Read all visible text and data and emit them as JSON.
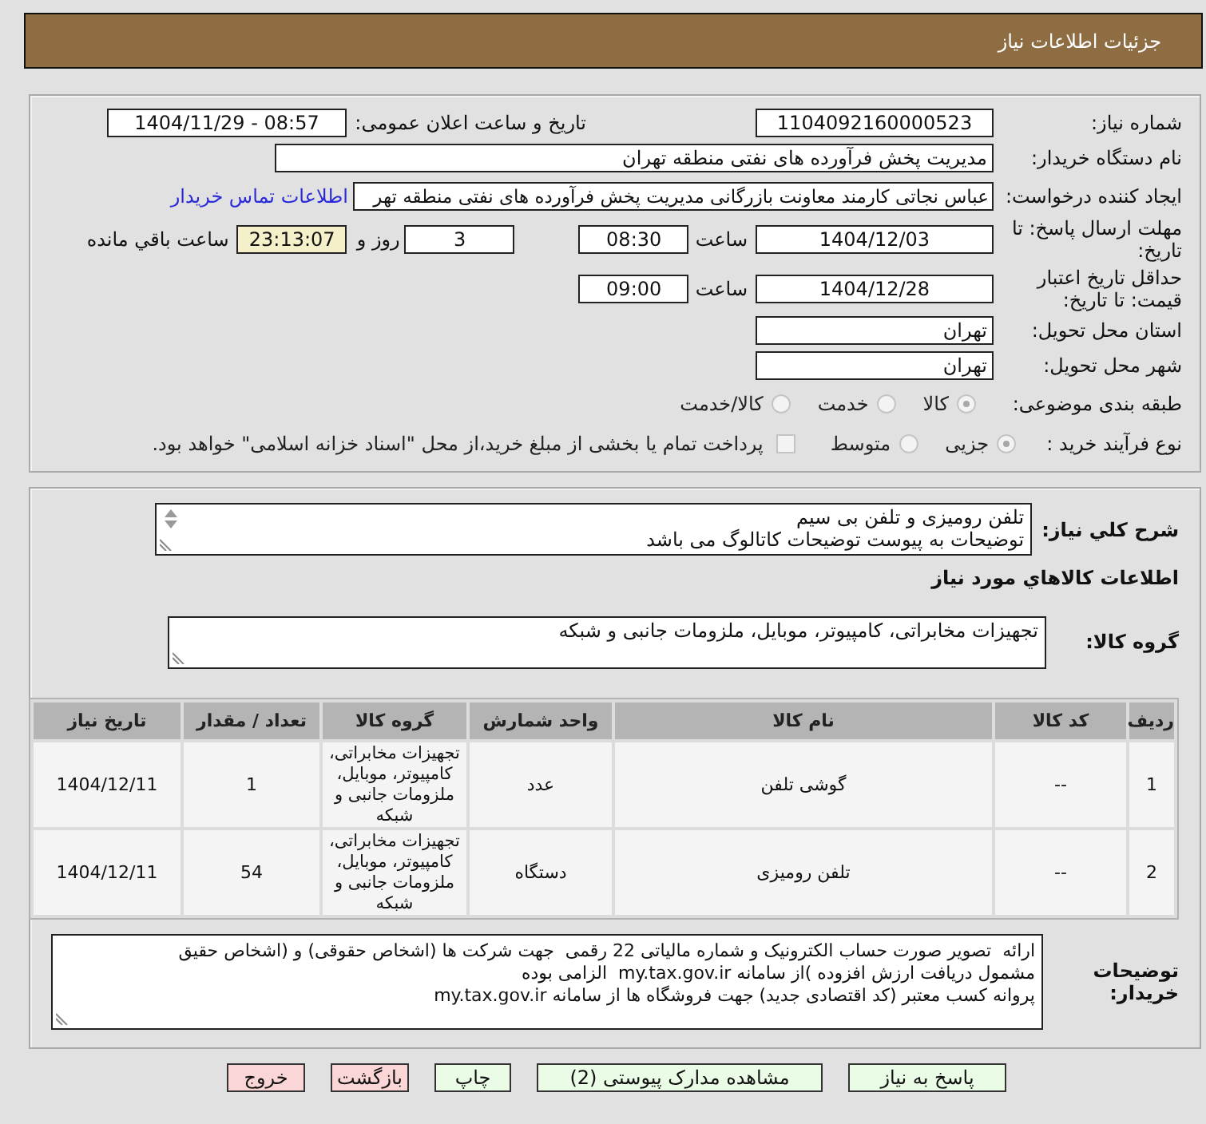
{
  "title_bar": {
    "title": "جزئیات اطلاعات نیاز"
  },
  "details": {
    "need_number": {
      "label": "شماره نیاز:",
      "value": "1104092160000523"
    },
    "announce": {
      "label": "تاریخ و ساعت اعلان عمومی:",
      "value": "1404/11/29 - 08:57"
    },
    "buyer": {
      "label": "نام دستگاه خریدار:",
      "value": "مدیریت پخش فرآورده های نفتی منطقه تهران"
    },
    "requester": {
      "label": "ایجاد کننده درخواست:",
      "value": "عباس نجاتی کارمند معاونت بازرگانی مدیریت پخش فرآورده های نفتی منطقه تهر",
      "link": "اطلاعات تماس خریدار"
    },
    "reply_deadline": {
      "label": "مهلت ارسال پاسخ: تا تاریخ:",
      "date": "1404/12/03",
      "time_label": "ساعت",
      "time": "08:30",
      "days": "3",
      "days_label": "روز و",
      "remaining": "23:13:07",
      "remaining_label": "ساعت باقي مانده"
    },
    "price_validity": {
      "label": "حداقل تاریخ اعتبار قیمت: تا تاریخ:",
      "date": "1404/12/28",
      "time_label": "ساعت",
      "time": "09:00"
    },
    "province": {
      "label": "استان محل تحویل:",
      "value": "تهران"
    },
    "city": {
      "label": "شهر محل تحویل:",
      "value": "تهران"
    },
    "category": {
      "label": "طبقه بندی موضوعی:",
      "options": [
        {
          "label": "کالا",
          "selected": true,
          "disabled": true
        },
        {
          "label": "خدمت",
          "selected": false,
          "disabled": true
        },
        {
          "label": "کالا/خدمت",
          "selected": false,
          "disabled": true
        }
      ]
    },
    "process": {
      "label": "نوع فرآیند خرید :",
      "options": [
        {
          "label": "جزیی",
          "selected": true,
          "disabled": true
        },
        {
          "label": "متوسط",
          "selected": false,
          "disabled": true
        }
      ],
      "treasury": {
        "label": "پرداخت تمام یا بخشی از مبلغ خرید،از محل \"اسناد خزانه اسلامی\" خواهد بود.",
        "checked": false,
        "disabled": true
      }
    }
  },
  "need": {
    "description_label": "شرح كلي نياز:",
    "description": "تلفن رومیزی و تلفن بی سیم\nتوضیحات به پیوست توضیحات کاتالوگ می باشد",
    "items_title": "اطلاعات كالاهاي مورد نياز",
    "group_label": "گروه کالا:",
    "group": "تجهیزات مخابراتی، کامپیوتر، موبایل، ملزومات جانبی و شبکه",
    "table": {
      "columns": [
        "ردیف",
        "کد کالا",
        "نام کالا",
        "واحد شمارش",
        "گروه کالا",
        "تعداد / مقدار",
        "تاریخ نیاز"
      ],
      "rows": [
        [
          "1",
          "--",
          "گوشی تلفن",
          "عدد",
          "تجهیزات مخابراتی، کامپیوتر، موبایل، ملزومات جانبی و شبکه",
          "1",
          "1404/12/11"
        ],
        [
          "2",
          "--",
          "تلفن رومیزی",
          "دستگاه",
          "تجهیزات مخابراتی، کامپیوتر، موبایل، ملزومات جانبی و شبکه",
          "54",
          "1404/12/11"
        ]
      ]
    },
    "notes_label": "توضیحات خریدار:",
    "notes": "ارائه  تصویر صورت حساب الکترونیک و شماره مالیاتی 22 رقمی  جهت شرکت ها (اشخاص حقوقی) و (اشخاص حقیق\nمشمول دریافت ارزش افزوده )از سامانه my.tax.gov.ir  الزامی بوده\nپروانه کسب معتبر (کد اقتصادی جدید) جهت فروشگاه ها از سامانه my.tax.gov.ir"
  },
  "buttons": [
    {
      "label": "پاسخ به نیاز",
      "kind": "action"
    },
    {
      "label": "مشاهده مدارک پیوستی (2)",
      "kind": "action"
    },
    {
      "label": "چاپ",
      "kind": "action"
    },
    {
      "label": "بازگشت",
      "kind": "exit"
    },
    {
      "label": "خروج",
      "kind": "exit"
    }
  ]
}
